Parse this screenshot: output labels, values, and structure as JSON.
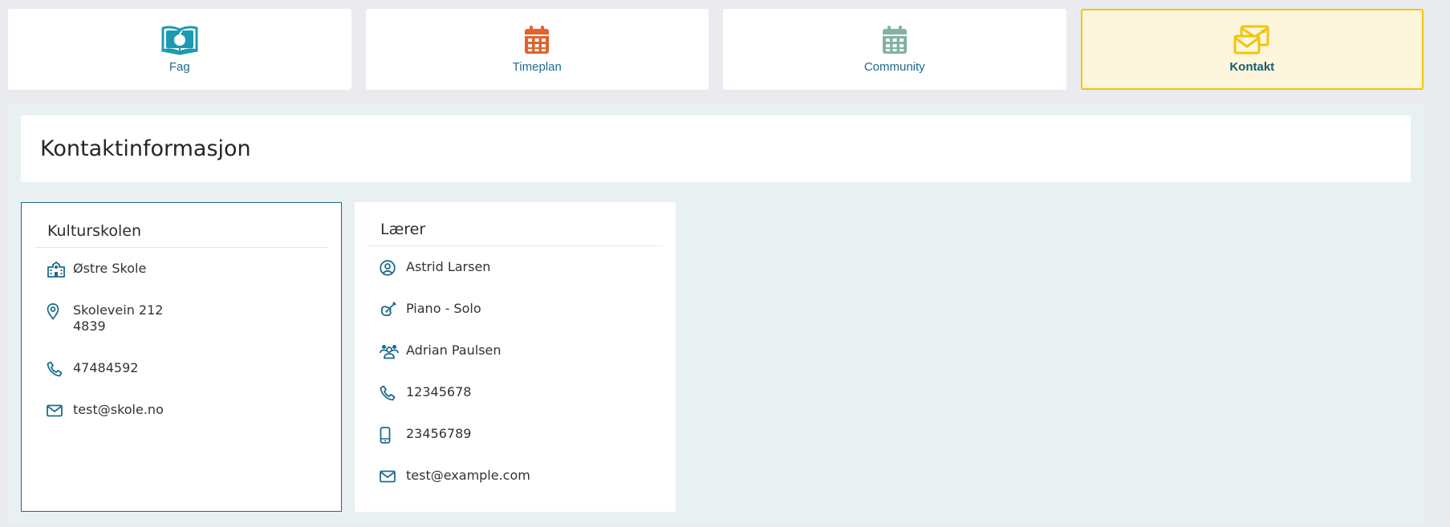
{
  "nav": {
    "tabs": [
      {
        "label": "Fag",
        "icon": "book-apple-icon",
        "color": "#1a9bb1"
      },
      {
        "label": "Timeplan",
        "icon": "calendar-icon",
        "color": "#e1632b"
      },
      {
        "label": "Community",
        "icon": "calendar-icon",
        "color": "#84b1a2"
      },
      {
        "label": "Kontakt",
        "icon": "envelopes-icon",
        "color": "#f2c40a",
        "active": true
      }
    ]
  },
  "page": {
    "title": "Kontaktinformasjon"
  },
  "school": {
    "heading": "Kulturskolen",
    "name": "Østre Skole",
    "address_line1": "Skolevein 212",
    "address_line2": "4839",
    "phone": "47484592",
    "email": "test@skole.no"
  },
  "teacher": {
    "heading": "Lærer",
    "name": "Astrid Larsen",
    "subject": "Piano - Solo",
    "student": "Adrian Paulsen",
    "phone": "12345678",
    "mobile": "23456789",
    "email": "test@example.com"
  },
  "colors": {
    "accent": "#1d6b8c",
    "active_border": "#f2c40a",
    "active_bg": "#fdf6dc"
  }
}
